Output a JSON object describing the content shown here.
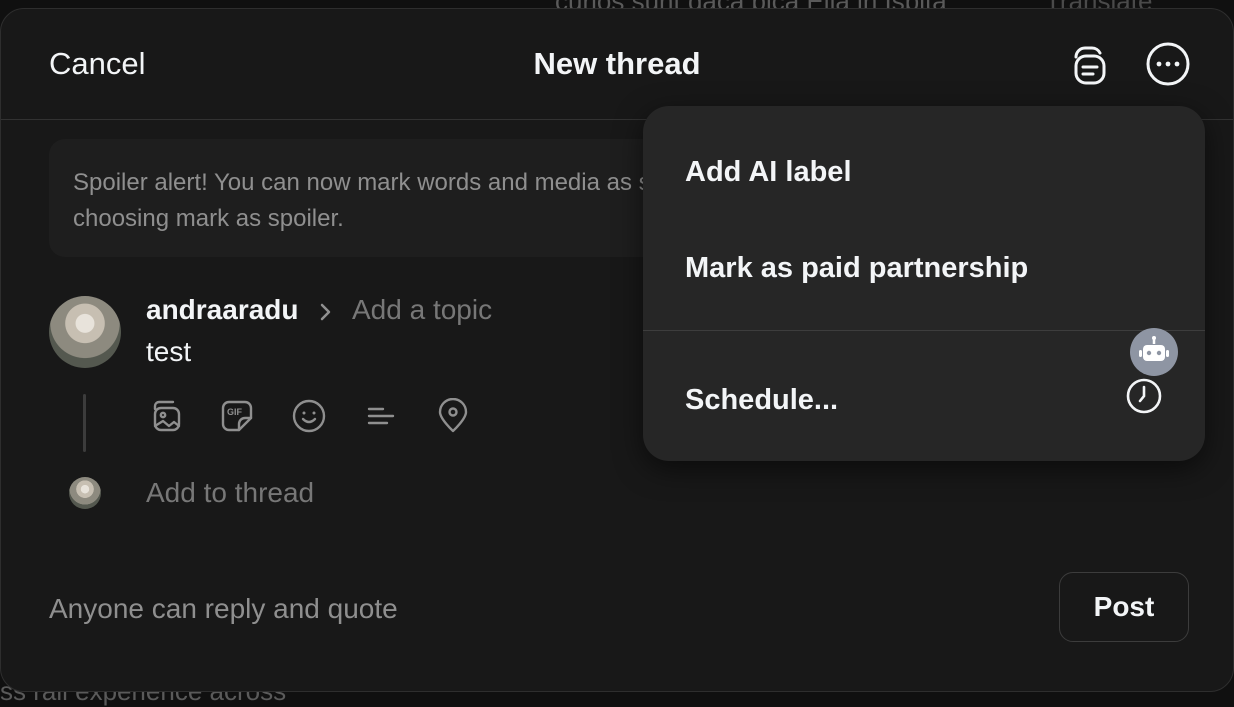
{
  "background": {
    "top_text": "curios sunt daca pica Ella in Ispita",
    "translate": "Translate",
    "bottom_text": "ss rail experience across"
  },
  "header": {
    "cancel": "Cancel",
    "title": "New thread",
    "icons": [
      "drafts-icon",
      "more-options-icon"
    ]
  },
  "banner": {
    "text": "Spoiler alert! You can now mark words and media as spoilers by choosing mark as spoiler."
  },
  "composer": {
    "username": "andraaradu",
    "topic_placeholder": "Add a topic",
    "post_text": "test",
    "toolbar_icons": [
      "media-icon",
      "gif-icon",
      "emoji-icon",
      "poll-icon",
      "location-icon"
    ],
    "add_to_thread": "Add to thread"
  },
  "footer": {
    "reply_option": "Anyone can reply and quote",
    "post_label": "Post"
  },
  "menu": {
    "items": [
      {
        "label": "Add AI label"
      },
      {
        "label": "Mark as paid partnership"
      },
      {
        "label": "Schedule...",
        "icon": "clock-icon"
      }
    ]
  },
  "colors": {
    "background": "#101010",
    "modal": "#181818",
    "menu": "#262626",
    "text_primary": "#f3f5f7",
    "text_secondary": "#777777"
  }
}
